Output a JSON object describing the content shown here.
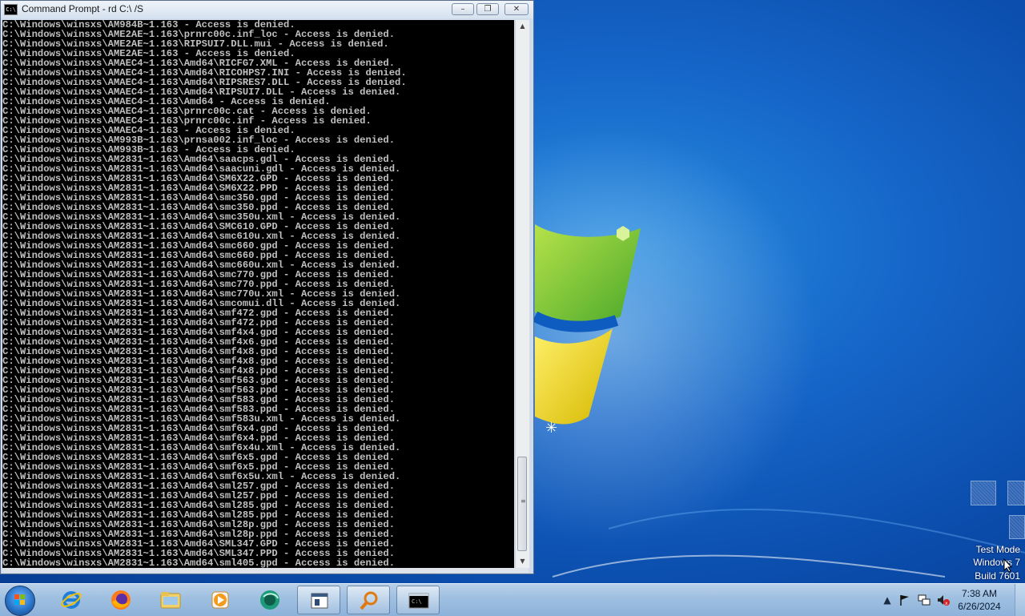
{
  "window": {
    "title": "Command Prompt - rd  C:\\ /S",
    "minimize": "–",
    "maximize": "❐",
    "close": "✕"
  },
  "console_lines": [
    "C:\\Windows\\winsxs\\AM984B~1.163 - Access is denied.",
    "C:\\Windows\\winsxs\\AME2AE~1.163\\prnrc00c.inf_loc - Access is denied.",
    "C:\\Windows\\winsxs\\AME2AE~1.163\\RIPSUI7.DLL.mui - Access is denied.",
    "C:\\Windows\\winsxs\\AME2AE~1.163 - Access is denied.",
    "C:\\Windows\\winsxs\\AMAEC4~1.163\\Amd64\\RICFG7.XML - Access is denied.",
    "C:\\Windows\\winsxs\\AMAEC4~1.163\\Amd64\\RICOHPS7.INI - Access is denied.",
    "C:\\Windows\\winsxs\\AMAEC4~1.163\\Amd64\\RIPSRES7.DLL - Access is denied.",
    "C:\\Windows\\winsxs\\AMAEC4~1.163\\Amd64\\RIPSUI7.DLL - Access is denied.",
    "C:\\Windows\\winsxs\\AMAEC4~1.163\\Amd64 - Access is denied.",
    "C:\\Windows\\winsxs\\AMAEC4~1.163\\prnrc00c.cat - Access is denied.",
    "C:\\Windows\\winsxs\\AMAEC4~1.163\\prnrc00c.inf - Access is denied.",
    "C:\\Windows\\winsxs\\AMAEC4~1.163 - Access is denied.",
    "C:\\Windows\\winsxs\\AM993B~1.163\\prnsa002.inf_loc - Access is denied.",
    "C:\\Windows\\winsxs\\AM993B~1.163 - Access is denied.",
    "C:\\Windows\\winsxs\\AM2831~1.163\\Amd64\\saacps.gdl - Access is denied.",
    "C:\\Windows\\winsxs\\AM2831~1.163\\Amd64\\saacuni.gdl - Access is denied.",
    "C:\\Windows\\winsxs\\AM2831~1.163\\Amd64\\SM6X22.GPD - Access is denied.",
    "C:\\Windows\\winsxs\\AM2831~1.163\\Amd64\\SM6X22.PPD - Access is denied.",
    "C:\\Windows\\winsxs\\AM2831~1.163\\Amd64\\smc350.gpd - Access is denied.",
    "C:\\Windows\\winsxs\\AM2831~1.163\\Amd64\\smc350.ppd - Access is denied.",
    "C:\\Windows\\winsxs\\AM2831~1.163\\Amd64\\smc350u.xml - Access is denied.",
    "C:\\Windows\\winsxs\\AM2831~1.163\\Amd64\\SMC610.GPD - Access is denied.",
    "C:\\Windows\\winsxs\\AM2831~1.163\\Amd64\\smc610u.xml - Access is denied.",
    "C:\\Windows\\winsxs\\AM2831~1.163\\Amd64\\smc660.gpd - Access is denied.",
    "C:\\Windows\\winsxs\\AM2831~1.163\\Amd64\\smc660.ppd - Access is denied.",
    "C:\\Windows\\winsxs\\AM2831~1.163\\Amd64\\smc660u.xml - Access is denied.",
    "C:\\Windows\\winsxs\\AM2831~1.163\\Amd64\\smc770.gpd - Access is denied.",
    "C:\\Windows\\winsxs\\AM2831~1.163\\Amd64\\smc770.ppd - Access is denied.",
    "C:\\Windows\\winsxs\\AM2831~1.163\\Amd64\\smc770u.xml - Access is denied.",
    "C:\\Windows\\winsxs\\AM2831~1.163\\Amd64\\smcomui.dll - Access is denied.",
    "C:\\Windows\\winsxs\\AM2831~1.163\\Amd64\\smf472.gpd - Access is denied.",
    "C:\\Windows\\winsxs\\AM2831~1.163\\Amd64\\smf472.ppd - Access is denied.",
    "C:\\Windows\\winsxs\\AM2831~1.163\\Amd64\\smf4x4.gpd - Access is denied.",
    "C:\\Windows\\winsxs\\AM2831~1.163\\Amd64\\smf4x6.gpd - Access is denied.",
    "C:\\Windows\\winsxs\\AM2831~1.163\\Amd64\\smf4x8.gpd - Access is denied.",
    "C:\\Windows\\winsxs\\AM2831~1.163\\Amd64\\smf4x8.gpd - Access is denied.",
    "C:\\Windows\\winsxs\\AM2831~1.163\\Amd64\\smf4x8.ppd - Access is denied.",
    "C:\\Windows\\winsxs\\AM2831~1.163\\Amd64\\smf563.gpd - Access is denied.",
    "C:\\Windows\\winsxs\\AM2831~1.163\\Amd64\\smf563.ppd - Access is denied.",
    "C:\\Windows\\winsxs\\AM2831~1.163\\Amd64\\smf583.gpd - Access is denied.",
    "C:\\Windows\\winsxs\\AM2831~1.163\\Amd64\\smf583.ppd - Access is denied.",
    "C:\\Windows\\winsxs\\AM2831~1.163\\Amd64\\smf583u.xml - Access is denied.",
    "C:\\Windows\\winsxs\\AM2831~1.163\\Amd64\\smf6x4.gpd - Access is denied.",
    "C:\\Windows\\winsxs\\AM2831~1.163\\Amd64\\smf6x4.ppd - Access is denied.",
    "C:\\Windows\\winsxs\\AM2831~1.163\\Amd64\\smf6x4u.xml - Access is denied.",
    "C:\\Windows\\winsxs\\AM2831~1.163\\Amd64\\smf6x5.gpd - Access is denied.",
    "C:\\Windows\\winsxs\\AM2831~1.163\\Amd64\\smf6x5.ppd - Access is denied.",
    "C:\\Windows\\winsxs\\AM2831~1.163\\Amd64\\smf6x5u.xml - Access is denied.",
    "C:\\Windows\\winsxs\\AM2831~1.163\\Amd64\\sml257.gpd - Access is denied.",
    "C:\\Windows\\winsxs\\AM2831~1.163\\Amd64\\sml257.ppd - Access is denied.",
    "C:\\Windows\\winsxs\\AM2831~1.163\\Amd64\\sml285.gpd - Access is denied.",
    "C:\\Windows\\winsxs\\AM2831~1.163\\Amd64\\sml285.ppd - Access is denied.",
    "C:\\Windows\\winsxs\\AM2831~1.163\\Amd64\\sml28p.gpd - Access is denied.",
    "C:\\Windows\\winsxs\\AM2831~1.163\\Amd64\\sml28p.ppd - Access is denied.",
    "C:\\Windows\\winsxs\\AM2831~1.163\\Amd64\\SML347.GPD - Access is denied.",
    "C:\\Windows\\winsxs\\AM2831~1.163\\Amd64\\SML347.PPD - Access is denied.",
    "C:\\Windows\\winsxs\\AM2831~1.163\\Amd64\\sml405.gpd - Access is denied."
  ],
  "watermark": {
    "line1": "Test Mode",
    "line2": "Windows 7",
    "line3": "Build 7601"
  },
  "taskbar": {
    "apps": [
      {
        "name": "internet-explorer",
        "active": false
      },
      {
        "name": "firefox",
        "active": false
      },
      {
        "name": "file-explorer",
        "active": false
      },
      {
        "name": "media-player",
        "active": false
      },
      {
        "name": "globe-app",
        "active": false
      },
      {
        "name": "window-app",
        "active": true
      },
      {
        "name": "search-app",
        "active": true
      },
      {
        "name": "command-prompt",
        "active": true
      }
    ],
    "clock_time": "7:38 AM",
    "clock_date": "6/26/2024"
  },
  "colors": {
    "desktop_blue": "#1565c8",
    "console_bg": "#000000",
    "console_fg": "#c0c0c0"
  }
}
